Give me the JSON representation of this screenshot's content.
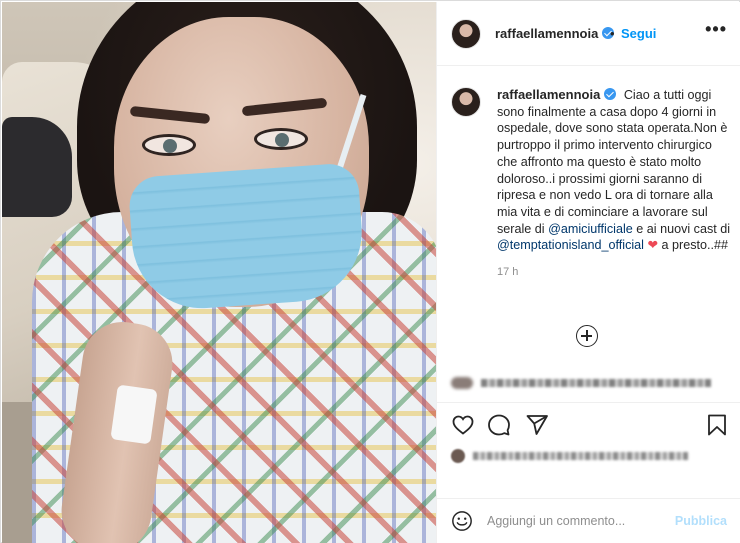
{
  "post": {
    "username": "raffaellamennoia",
    "separator": "•",
    "follow_label": "Segui",
    "more_label": "•••",
    "caption_prefix": "Ciao a tutti oggi sono finalmente a casa dopo 4 giorni in ospedale, dove sono stata operata.Non è purtroppo il primo intervento chirurgico che affronto ma questo è stato molto doloroso..i prossimi giorni saranno di ripresa e non vedo L ora di tornare alla mia vita e di cominciare a lavorare sul serale di",
    "mention_1": "@amiciufficiale",
    "caption_middle": "e ai nuovi cast di",
    "mention_2": "@temptationisland_official",
    "heart": "❤",
    "caption_suffix": "a presto..##",
    "time_ago": "17 h"
  },
  "actions": {
    "like": "heart-icon",
    "comment": "comment-icon",
    "share": "paper-plane-icon",
    "save": "bookmark-icon"
  },
  "comment_box": {
    "placeholder": "Aggiungi un commento...",
    "publish_label": "Pubblica"
  },
  "colors": {
    "link_blue": "#0095f6",
    "mention_blue": "#00376b",
    "heart_red": "#ed4956",
    "publish_disabled": "#b2dffc",
    "verified": "#3897f0"
  }
}
